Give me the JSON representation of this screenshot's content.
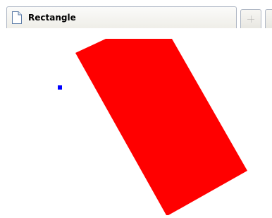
{
  "tab": {
    "title": "Rectangle",
    "icon": "document-icon"
  },
  "new_tab_button": {
    "icon": "plus-icon"
  },
  "canvas": {
    "background": "#ffffff",
    "shape": {
      "type": "rectangle",
      "fill": "#ff0000"
    },
    "handle": {
      "color": "#0000ff"
    }
  }
}
